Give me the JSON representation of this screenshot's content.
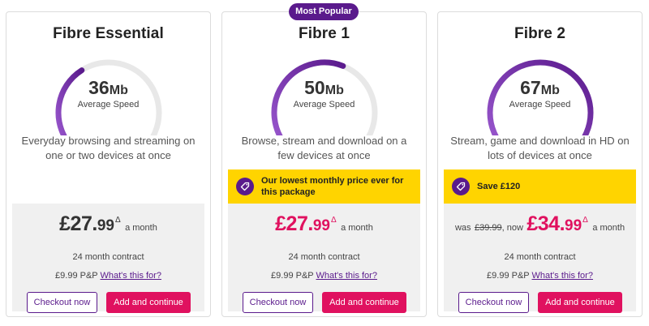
{
  "badge": "Most Popular",
  "common": {
    "avg_label": "Average Speed",
    "unit": "Mb",
    "per_month": "a month",
    "contract": "24 month contract",
    "pp_text": "£9.99 P&P",
    "pp_link": "What's this for?",
    "checkout_label": "Checkout now",
    "add_label": "Add and continue",
    "delta_symbol": "Δ",
    "colors": {
      "purple": "#5a1a8c",
      "gauge_light": "#9b59d0",
      "pink": "#e0115f",
      "offer_yellow": "#ffd400",
      "track": "#e8e8e8"
    }
  },
  "plans": [
    {
      "title": "Fibre Essential",
      "speed": "36",
      "gauge_fill_fraction": 0.38,
      "description": "Everyday browsing and streaming on one or two devices at once",
      "offer": "",
      "was_label": "",
      "was_price": "",
      "now_label": "",
      "price_pounds": "£27.",
      "price_pence": "99"
    },
    {
      "title": "Fibre 1",
      "speed": "50",
      "gauge_fill_fraction": 0.58,
      "description": "Browse, stream and download on a few devices at once",
      "offer": "Our lowest monthly price ever for this package",
      "was_label": "",
      "was_price": "",
      "now_label": "",
      "price_pounds": "£27.",
      "price_pence": "99"
    },
    {
      "title": "Fibre 2",
      "speed": "67",
      "gauge_fill_fraction": 1.0,
      "description": "Stream, game and download in HD on lots of devices at once",
      "offer": "Save £120",
      "was_label": "was",
      "was_price": "£39.99",
      "now_label": ", now",
      "price_pounds": "£34.",
      "price_pence": "99"
    }
  ]
}
